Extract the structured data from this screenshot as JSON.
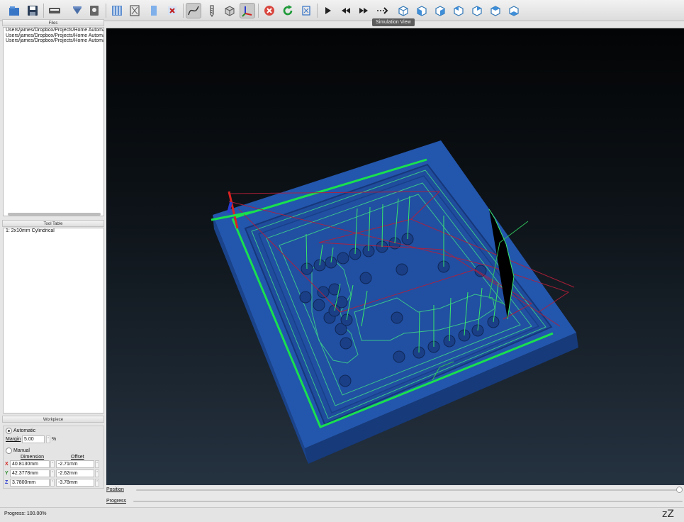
{
  "toolbar": {
    "icons": [
      "open-file-icon",
      "save-icon",
      "edit-gcode-icon",
      "import-stl-icon",
      "tool-icon",
      "roughing-icon",
      "finishing-icon",
      "stock-icon",
      "remove-icon",
      "curve-icon",
      "drill-icon",
      "box-icon",
      "axis-icon",
      "stop-icon",
      "refresh-icon",
      "export-icon",
      "play-icon",
      "rewind-icon",
      "fast-forward-icon",
      "step-icon",
      "view-iso-icon",
      "view-front-icon",
      "view-back-icon",
      "view-left-icon",
      "view-right-icon",
      "view-top-icon",
      "view-bottom-icon"
    ],
    "tooltip": "Simulation View"
  },
  "files": {
    "title": "Files",
    "items": [
      "Users/james/Dropbox/Projects/Home Automatic",
      "Users/james/Dropbox/Projects/Home Automatic",
      "Users/james/Dropbox/Projects/Home Automatic"
    ]
  },
  "tool_table": {
    "title": "Tool Table",
    "items": [
      "1: 2x10mm Cylindrical"
    ]
  },
  "workpiece": {
    "title": "Workpiece",
    "automatic_label": "Automatic",
    "margin_label": "Margin",
    "margin_value": "5.00",
    "margin_unit": "%",
    "manual_label": "Manual",
    "dimension_header": "Dimension",
    "offset_header": "Offset",
    "rows": [
      {
        "axis": "X",
        "dimension": "40.8130mm",
        "offset": "-2.71mm"
      },
      {
        "axis": "Y",
        "dimension": "42.3778mm",
        "offset": "-2.62mm"
      },
      {
        "axis": "Z",
        "dimension": "3.7800mm",
        "offset": "-3.78mm"
      }
    ]
  },
  "position_label": "Position",
  "position_value": 1.0,
  "progress_label": "Progress",
  "status": "Progress: 100.00%",
  "sleep_icon_text": "zZ",
  "colors": {
    "stock": "#1f4fa3",
    "toolpath_green": "#35e07a",
    "rapid_red": "#c0223a",
    "accent": "#3a76c6"
  }
}
